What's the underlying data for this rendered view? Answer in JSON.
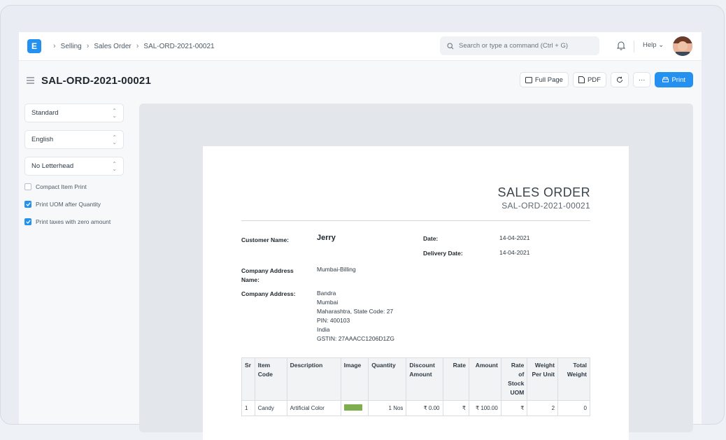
{
  "navbar": {
    "logo_letter": "E",
    "breadcrumbs": [
      "Selling",
      "Sales Order",
      "SAL-ORD-2021-00021"
    ],
    "search_placeholder": "Search or type a command (Ctrl + G)",
    "help_label": "Help"
  },
  "page": {
    "title": "SAL-ORD-2021-00021",
    "actions": {
      "full_page": "Full Page",
      "pdf": "PDF",
      "more": "···",
      "print": "Print"
    }
  },
  "sidebar": {
    "selects": [
      "Standard",
      "English",
      "No Letterhead"
    ],
    "options": [
      {
        "label": "Compact Item Print",
        "checked": false
      },
      {
        "label": "Print UOM after Quantity",
        "checked": true
      },
      {
        "label": "Print taxes with zero amount",
        "checked": true
      }
    ]
  },
  "document": {
    "heading": "SALES ORDER",
    "number": "SAL-ORD-2021-00021",
    "customer_label": "Customer Name:",
    "customer": "Jerry",
    "date_label": "Date:",
    "date": "14-04-2021",
    "delivery_label": "Delivery Date:",
    "delivery_date": "14-04-2021",
    "addr_name_label": "Company Address Name:",
    "addr_name": "Mumbai-Billing",
    "addr_label": "Company Address:",
    "addr_lines": [
      "Bandra",
      "Mumbai",
      "Maharashtra, State Code: 27",
      "PIN: 400103",
      "India",
      "GSTIN: 27AAACC1206D1ZG"
    ]
  },
  "items": {
    "headers": [
      "Sr",
      "Item Code",
      "Description",
      "Image",
      "Quantity",
      "Discount Amount",
      "Rate",
      "Amount",
      "Rate of Stock UOM",
      "Weight Per Unit",
      "Total Weight"
    ],
    "rows": [
      [
        "1",
        "Candy",
        "Artificial Color",
        "",
        "1 Nos",
        "₹ 0.00",
        "₹",
        "₹ 100.00",
        "₹",
        "2",
        "0"
      ]
    ]
  }
}
